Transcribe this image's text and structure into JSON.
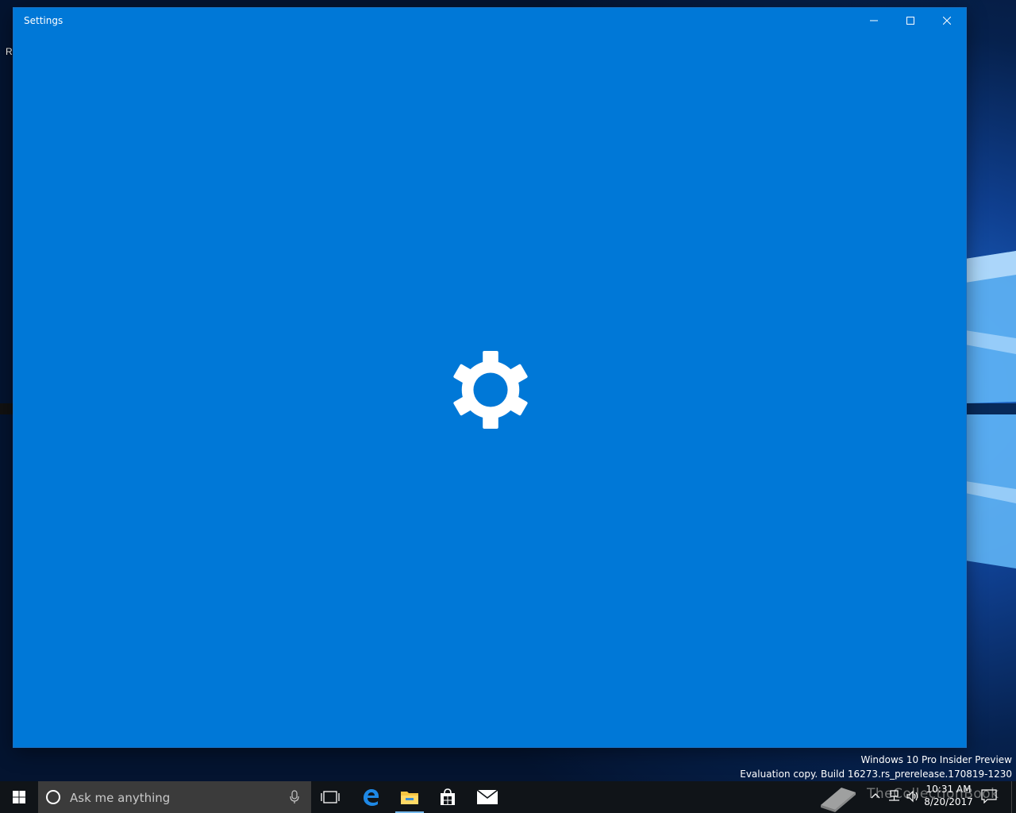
{
  "desktop": {
    "partial_label": "Re"
  },
  "window": {
    "title": "Settings",
    "accent_color": "#0078d7",
    "splash_icon": "gear-icon",
    "controls": {
      "minimize": "minimize-icon",
      "maximize": "maximize-icon",
      "close": "close-icon"
    }
  },
  "watermark": {
    "line1": "Windows 10 Pro Insider Preview",
    "line2": "Evaluation copy. Build 16273.rs_prerelease.170819-1230"
  },
  "taskbar": {
    "search_placeholder": "Ask me anything",
    "pinned": [
      "task-view-icon",
      "edge-icon",
      "file-explorer-icon",
      "store-icon",
      "mail-icon"
    ],
    "tray_overlay_text": "TheCollectionBook",
    "clock_time": "10:31 AM",
    "clock_date": "8/20/2017"
  }
}
